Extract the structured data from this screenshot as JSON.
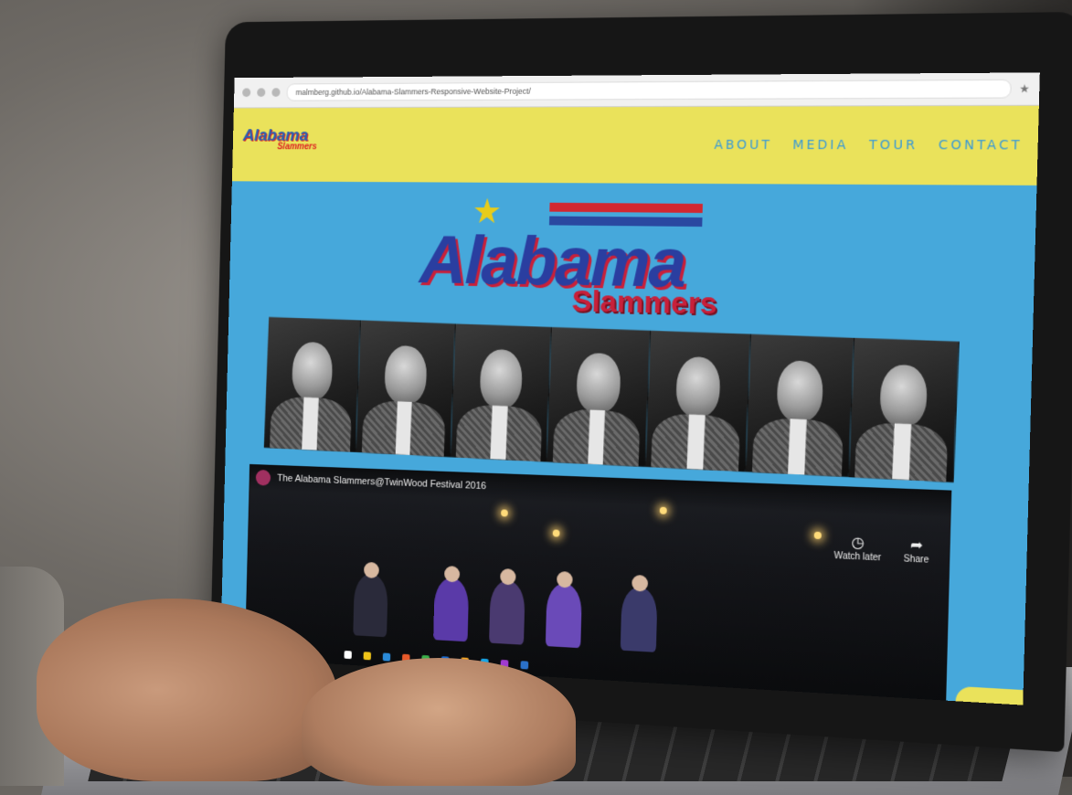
{
  "browser": {
    "url": "malmberg.github.io/Alabama-Slammers-Responsive-Website-Project/"
  },
  "site": {
    "logo_line1": "Alabama",
    "logo_line2": "Slammers",
    "nav": [
      "ABOUT",
      "MEDIA",
      "TOUR",
      "CONTACT"
    ]
  },
  "hero": {
    "title": "Alabama",
    "subtitle": "Slammers"
  },
  "band": {
    "member_count": 7
  },
  "video": {
    "title": "The Alabama Slammers@TwinWood Festival 2016",
    "watch_later": "Watch later",
    "share": "Share"
  },
  "colors": {
    "header_yellow": "#eae25b",
    "page_blue": "#46a8db",
    "nav_blue": "#3a9ad6",
    "logo_blue": "#2a3ea0",
    "logo_red": "#c8203a",
    "star_yellow": "#e8cc1a"
  },
  "icons": [
    "star-icon",
    "clock-icon",
    "share-icon"
  ]
}
